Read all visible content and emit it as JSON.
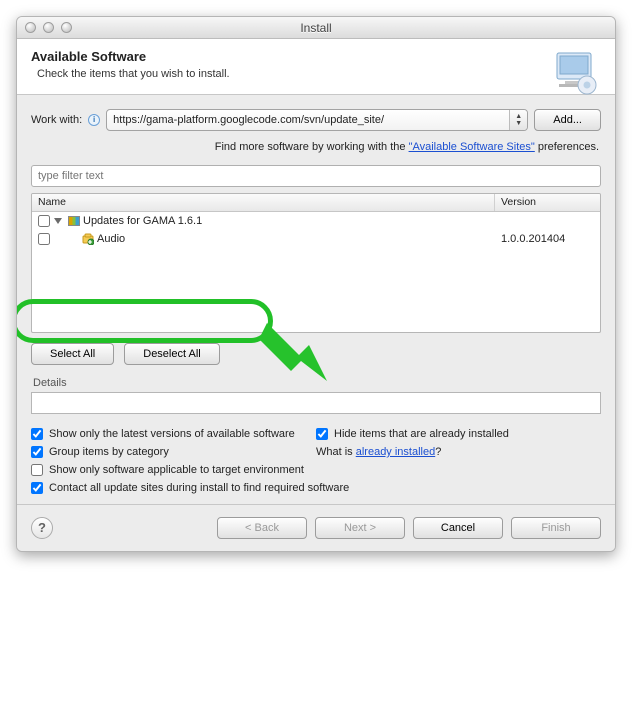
{
  "window": {
    "title": "Install"
  },
  "header": {
    "title": "Available Software",
    "subtitle": "Check the items that you wish to install."
  },
  "workwith": {
    "label": "Work with:",
    "value": "https://gama-platform.googlecode.com/svn/update_site/",
    "add_label": "Add..."
  },
  "find_line": {
    "prefix": "Find more software by working with the ",
    "link": "\"Available Software Sites\"",
    "suffix": " preferences."
  },
  "filter_placeholder": "type filter text",
  "columns": {
    "name": "Name",
    "version": "Version"
  },
  "tree": {
    "category": {
      "label": "Updates for GAMA 1.6.1",
      "checked": false
    },
    "items": [
      {
        "label": "Audio",
        "version": "1.0.0.201404",
        "checked": false
      }
    ]
  },
  "buttons": {
    "select_all": "Select All",
    "deselect_all": "Deselect All",
    "back": "< Back",
    "next": "Next >",
    "cancel": "Cancel",
    "finish": "Finish"
  },
  "details_label": "Details",
  "options": {
    "latest": {
      "label": "Show only the latest versions of available software",
      "checked": true
    },
    "hide_installed": {
      "label": "Hide items that are already installed",
      "checked": true
    },
    "group": {
      "label": "Group items by category",
      "checked": true
    },
    "whatis_prefix": "What is ",
    "whatis_link": "already installed",
    "whatis_suffix": "?",
    "target_env": {
      "label": "Show only software applicable to target environment",
      "checked": false
    },
    "contact": {
      "label": "Contact all update sites during install to find required software",
      "checked": true
    }
  }
}
